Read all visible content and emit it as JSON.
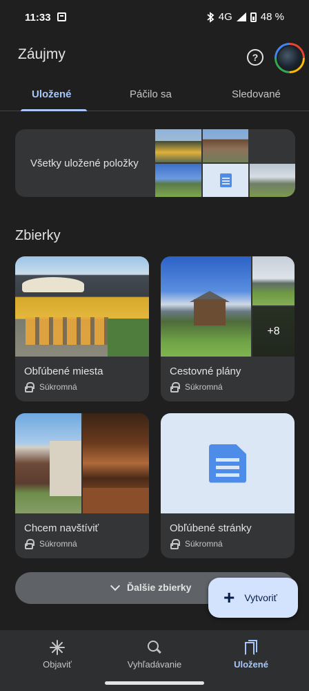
{
  "status_bar": {
    "time": "11:33",
    "network": "4G",
    "battery": "48 %"
  },
  "header": {
    "title": "Záujmy",
    "help_icon": "?"
  },
  "tabs": [
    {
      "label": "Uložené",
      "active": true
    },
    {
      "label": "Páčilo sa",
      "active": false
    },
    {
      "label": "Sledované",
      "active": false
    }
  ],
  "all_saved": {
    "label": "Všetky uložené položky"
  },
  "collections": {
    "title": "Zbierky",
    "items": [
      {
        "name": "Obľúbené miesta",
        "privacy": "Súkromná"
      },
      {
        "name": "Cestovné plány",
        "privacy": "Súkromná",
        "more_count": "+8"
      },
      {
        "name": "Chcem navštíviť",
        "privacy": "Súkromná"
      },
      {
        "name": "Obľúbené stránky",
        "privacy": "Súkromná"
      }
    ],
    "more_label": "Ďalšie zbierky"
  },
  "fab": {
    "label": "Vytvoriť"
  },
  "bottom_nav": [
    {
      "label": "Objaviť",
      "icon": "asterisk-icon",
      "active": false
    },
    {
      "label": "Vyhľadávanie",
      "icon": "search-icon",
      "active": false
    },
    {
      "label": "Uložené",
      "icon": "bookmarks-icon",
      "active": true
    }
  ],
  "colors": {
    "accent": "#a8c7fa",
    "background": "#1f1f1f",
    "card": "#333537",
    "fab": "#d3e3fd"
  }
}
